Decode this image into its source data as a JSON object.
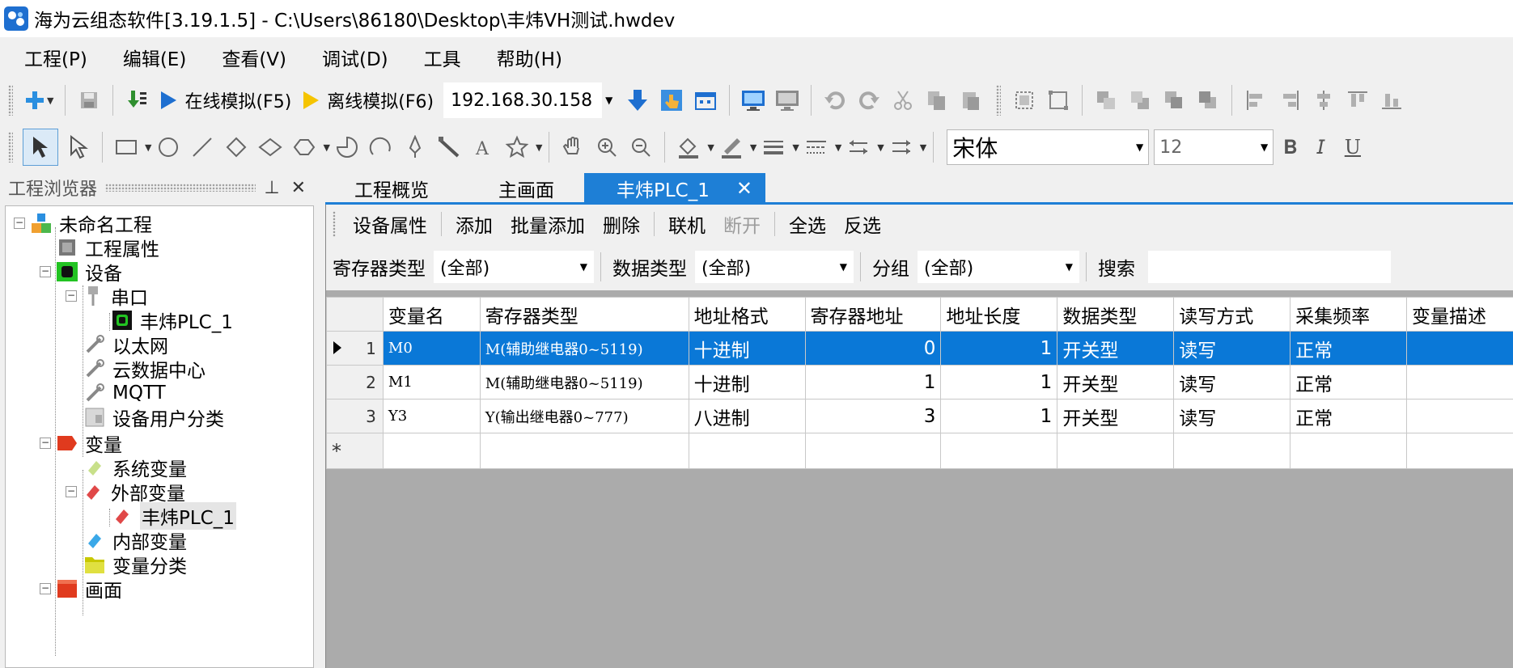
{
  "window": {
    "title": "海为云组态软件[3.19.1.5] - C:\\Users\\86180\\Desktop\\丰炜VH测试.hwdev"
  },
  "menu": [
    "工程(P)",
    "编辑(E)",
    "查看(V)",
    "调试(D)",
    "工具",
    "帮助(H)"
  ],
  "toolbar1": {
    "online_sim": "在线模拟(F5)",
    "offline_sim": "离线模拟(F6)",
    "ip_address": "192.168.30.158"
  },
  "toolbar2": {
    "font_name": "宋体",
    "font_size": "12"
  },
  "left_panel": {
    "title": "工程浏览器",
    "tree": [
      {
        "label": "未命名工程",
        "icon": "project-icon"
      },
      {
        "label": "工程属性",
        "icon": "properties-icon"
      },
      {
        "label": "设备",
        "icon": "device-icon"
      },
      {
        "label": "串口",
        "icon": "serial-port-icon"
      },
      {
        "label": "丰炜PLC_1",
        "icon": "plc-device-icon"
      },
      {
        "label": "以太网",
        "icon": "ethernet-icon"
      },
      {
        "label": "云数据中心",
        "icon": "cloud-data-icon"
      },
      {
        "label": "MQTT",
        "icon": "mqtt-icon"
      },
      {
        "label": "设备用户分类",
        "icon": "device-category-icon"
      },
      {
        "label": "变量",
        "icon": "variable-icon"
      },
      {
        "label": "系统变量",
        "icon": "system-variable-icon"
      },
      {
        "label": "外部变量",
        "icon": "external-variable-icon"
      },
      {
        "label": "丰炜PLC_1",
        "icon": "plc-variable-icon"
      },
      {
        "label": "内部变量",
        "icon": "internal-variable-icon"
      },
      {
        "label": "变量分类",
        "icon": "folder-icon"
      },
      {
        "label": "画面",
        "icon": "screen-icon"
      }
    ]
  },
  "doc_tabs": [
    "工程概览",
    "主画面",
    "丰炜PLC_1"
  ],
  "commands": [
    "设备属性",
    "添加",
    "批量添加",
    "删除",
    "联机",
    "断开",
    "全选",
    "反选"
  ],
  "filters": {
    "register_type_label": "寄存器类型",
    "register_type_value": "(全部)",
    "data_type_label": "数据类型",
    "data_type_value": "(全部)",
    "group_label": "分组",
    "group_value": "(全部)",
    "search_label": "搜索"
  },
  "table": {
    "columns": [
      "变量名",
      "寄存器类型",
      "地址格式",
      "寄存器地址",
      "地址长度",
      "数据类型",
      "读写方式",
      "采集频率",
      "变量描述"
    ],
    "rows": [
      {
        "no": "1",
        "name": "M0",
        "reg_type": "M(辅助继电器0~5119)",
        "addr_fmt": "十进制",
        "addr": "0",
        "len": "1",
        "dtype": "开关型",
        "rw": "读写",
        "freq": "正常",
        "desc": ""
      },
      {
        "no": "2",
        "name": "M1",
        "reg_type": "M(辅助继电器0~5119)",
        "addr_fmt": "十进制",
        "addr": "1",
        "len": "1",
        "dtype": "开关型",
        "rw": "读写",
        "freq": "正常",
        "desc": ""
      },
      {
        "no": "3",
        "name": "Y3",
        "reg_type": "Y(输出继电器0~777)",
        "addr_fmt": "八进制",
        "addr": "3",
        "len": "1",
        "dtype": "开关型",
        "rw": "读写",
        "freq": "正常",
        "desc": ""
      }
    ],
    "new_row_marker": "*",
    "selected_row": 1
  },
  "colors": {
    "accent": "#1e7fd6",
    "selection": "#0a78d7"
  }
}
